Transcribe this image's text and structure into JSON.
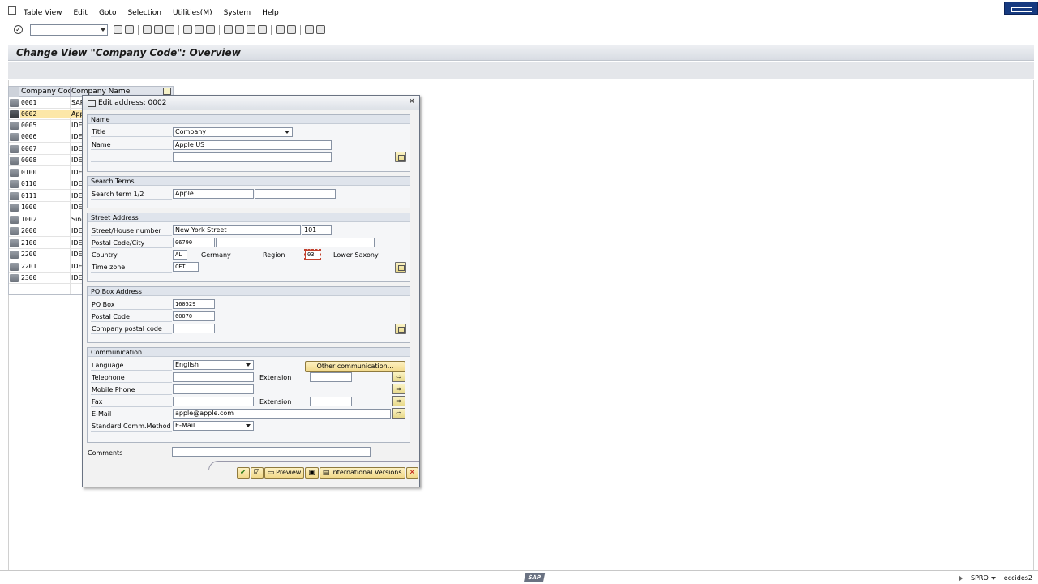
{
  "menu": [
    "Table View",
    "Edit",
    "Goto",
    "Selection",
    "Utilities(M)",
    "System",
    "Help"
  ],
  "page_title": "Change View \"Company Code\": Overview",
  "table": {
    "headers": [
      "Company Code",
      "Company Name"
    ],
    "rows": [
      {
        "code": "0001",
        "name": "SAP"
      },
      {
        "code": "0002",
        "name": "App"
      },
      {
        "code": "0005",
        "name": "IDE"
      },
      {
        "code": "0006",
        "name": "IDE"
      },
      {
        "code": "0007",
        "name": "IDE"
      },
      {
        "code": "0008",
        "name": "IDE"
      },
      {
        "code": "0100",
        "name": "IDE"
      },
      {
        "code": "0110",
        "name": "IDE"
      },
      {
        "code": "0111",
        "name": "IDE"
      },
      {
        "code": "1000",
        "name": "IDE"
      },
      {
        "code": "1002",
        "name": "Sing"
      },
      {
        "code": "2000",
        "name": "IDE"
      },
      {
        "code": "2100",
        "name": "IDE"
      },
      {
        "code": "2200",
        "name": "IDE"
      },
      {
        "code": "2201",
        "name": "IDE"
      },
      {
        "code": "2300",
        "name": "IDE"
      }
    ]
  },
  "dialog": {
    "title": "Edit address:  0002",
    "name_group": {
      "title": "Name",
      "title_label": "Title",
      "title_value": "Company",
      "name_label": "Name",
      "name_value": "Apple US",
      "name2_value": ""
    },
    "search_group": {
      "title": "Search Terms",
      "label": "Search term 1/2",
      "term1": "Apple",
      "term2": ""
    },
    "street_group": {
      "title": "Street Address",
      "street_label": "Street/House number",
      "street_value": "New York Street",
      "house_value": "101",
      "postal_label": "Postal Code/City",
      "postal_value": "06790",
      "city_value": "",
      "country_label": "Country",
      "country_value": "AL",
      "country_name": "Germany",
      "region_label": "Region",
      "region_value": "03",
      "region_name": "Lower Saxony",
      "tz_label": "Time zone",
      "tz_value": "CET"
    },
    "pobox_group": {
      "title": "PO Box Address",
      "pobox_label": "PO Box",
      "pobox_value": "160529",
      "postal_label": "Postal Code",
      "postal_value": "60070",
      "company_postal_label": "Company postal code",
      "company_postal_value": ""
    },
    "comm_group": {
      "title": "Communication",
      "language_label": "Language",
      "language_value": "English",
      "other_button": "Other communication...",
      "telephone_label": "Telephone",
      "telephone_value": "",
      "extension_label": "Extension",
      "extension_value": "",
      "mobile_label": "Mobile Phone",
      "mobile_value": "",
      "fax_label": "Fax",
      "fax_value": "",
      "fax_extension_label": "Extension",
      "fax_extension_value": "",
      "email_label": "E-Mail",
      "email_value": "apple@apple.com",
      "method_label": "Standard Comm.Method",
      "method_value": "E-Mail"
    },
    "comments_label": "Comments",
    "comments_value": "",
    "buttons": {
      "preview": "Preview",
      "international": "International Versions"
    }
  },
  "status": {
    "logo": "SAP",
    "transaction": "SPRO",
    "system": "eccides2"
  },
  "colors": {
    "highlight_row": "#fce7a8",
    "button_yellow": "#f2d98a",
    "title_bar": "#dde1e7"
  }
}
